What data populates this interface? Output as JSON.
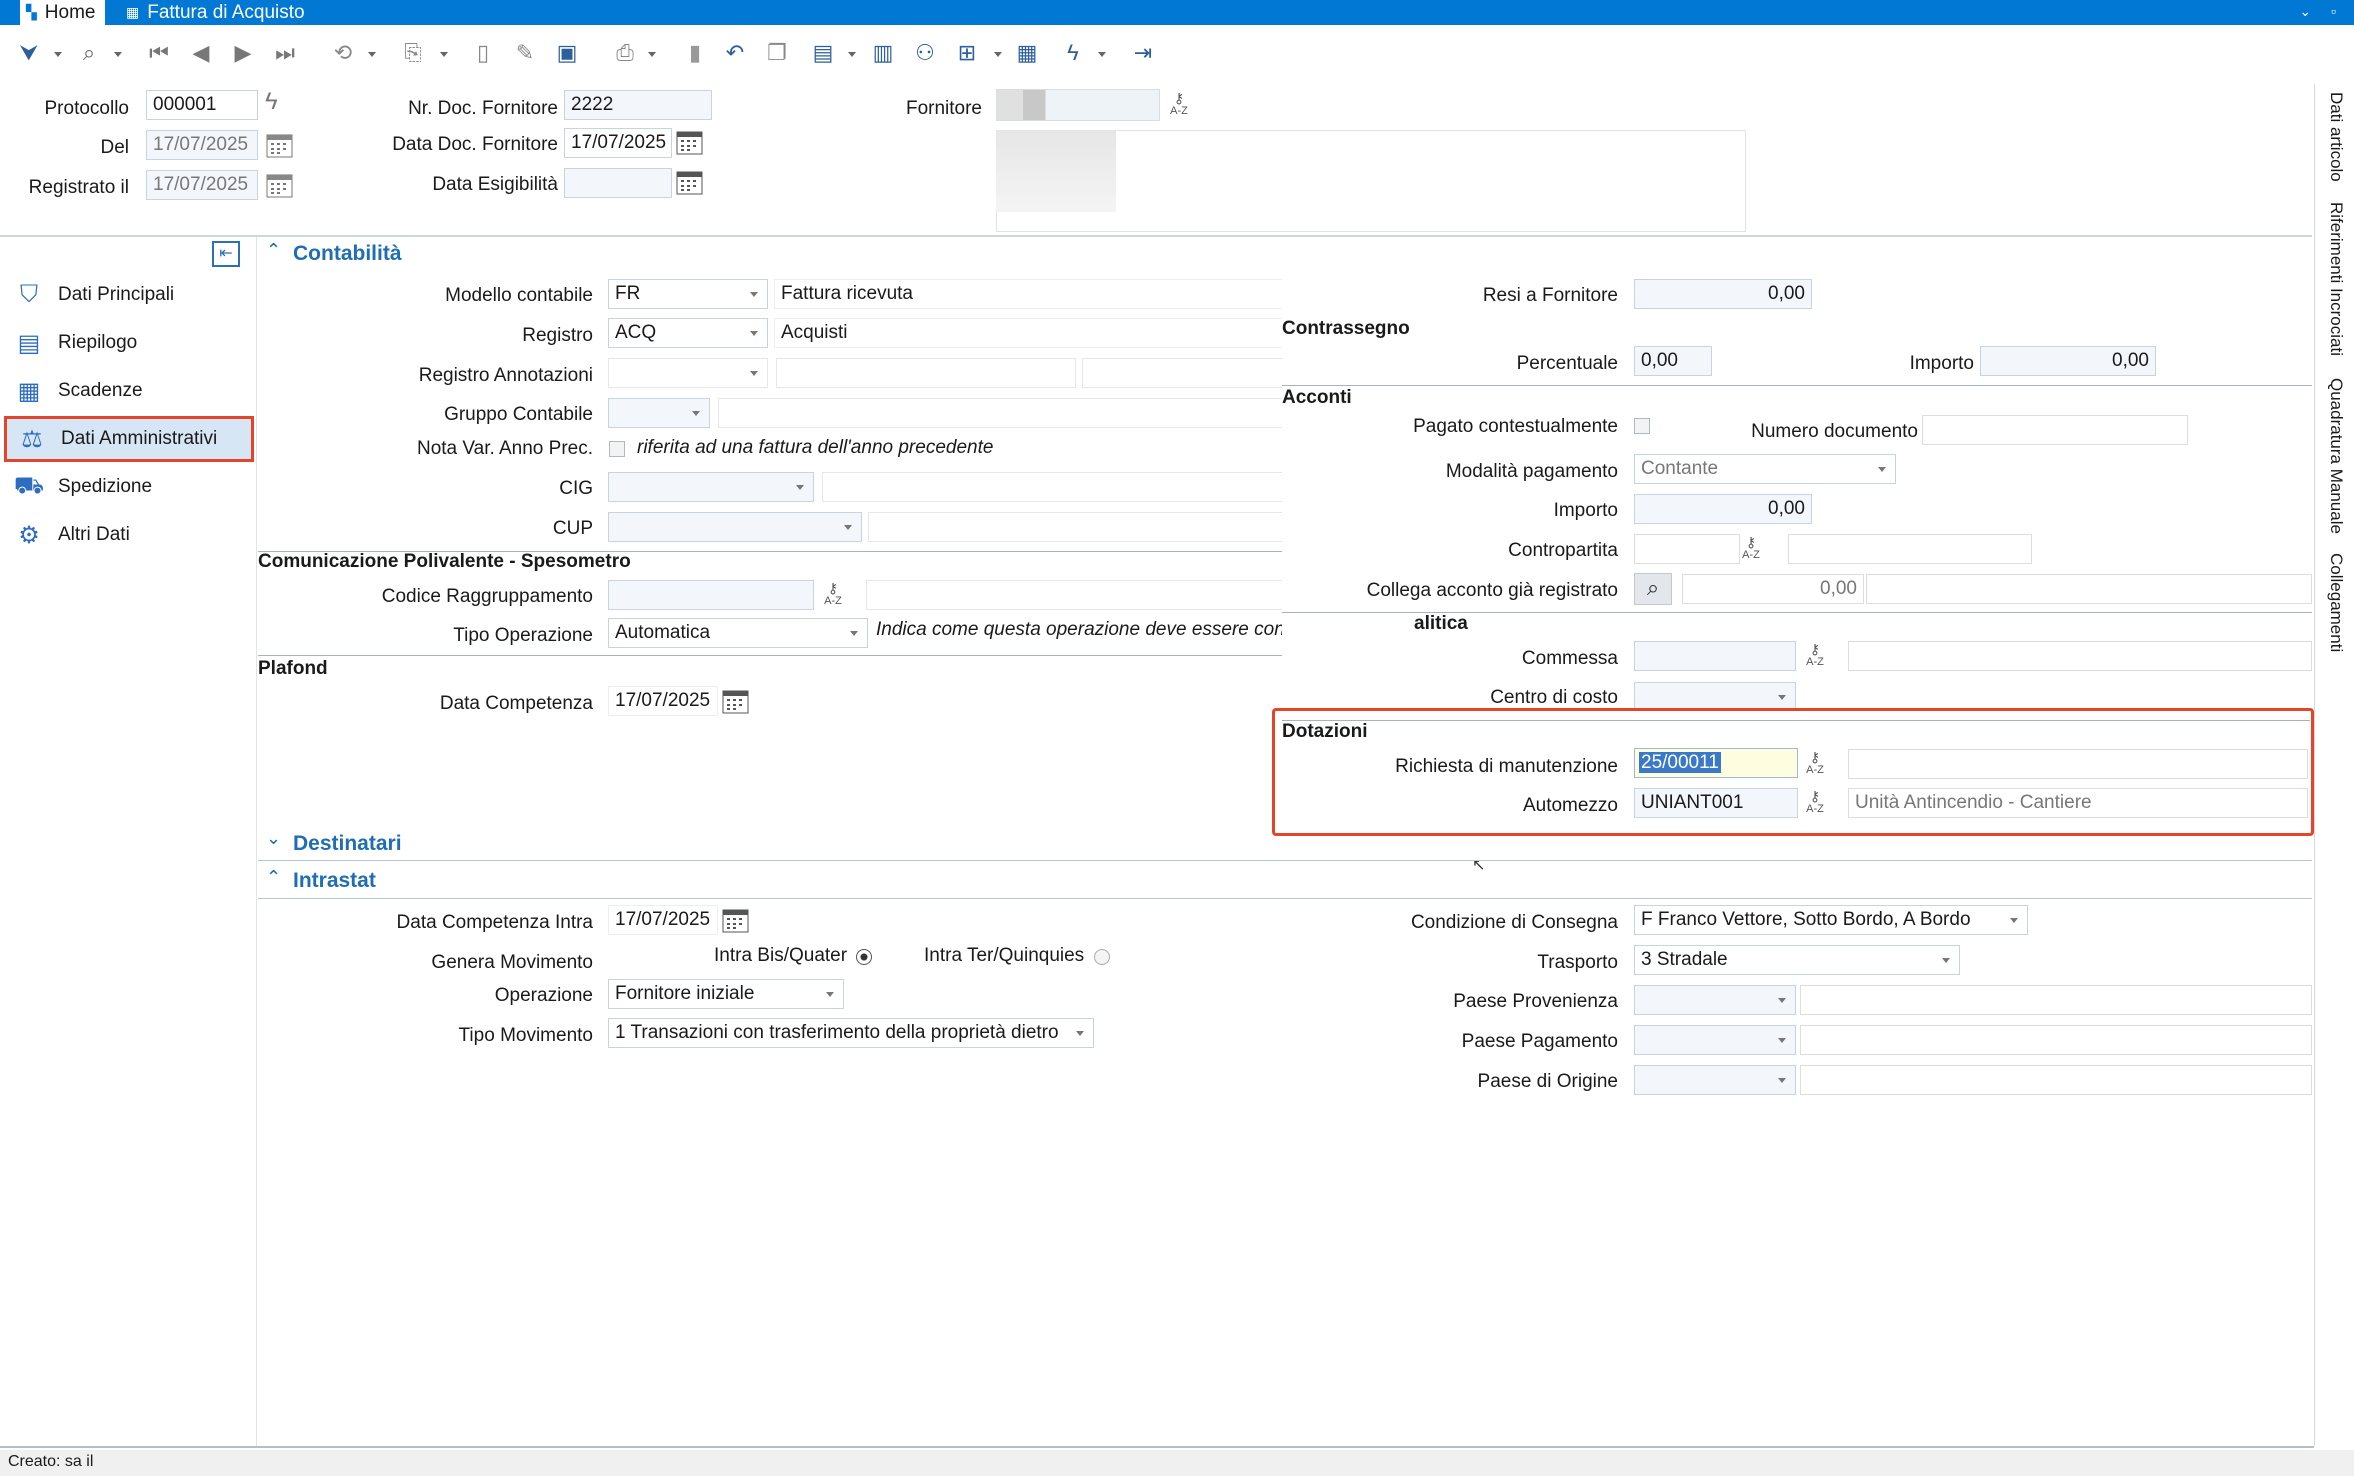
{
  "window": {
    "tabs": [
      {
        "label": "Home"
      },
      {
        "label": "Fattura di Acquisto"
      }
    ]
  },
  "colors": {
    "title_bar": "#0078d4",
    "highlight": "#e4442a",
    "section_header": "#1f6db4",
    "active_nav": "#d6e6f5"
  },
  "header": {
    "protocollo": {
      "label": "Protocollo",
      "value": "000001"
    },
    "del": {
      "label": "Del",
      "value": "17/07/2025"
    },
    "registrato": {
      "label": "Registrato il",
      "value": "17/07/2025"
    },
    "nr_doc": {
      "label": "Nr. Doc. Fornitore",
      "value": "2222"
    },
    "data_doc": {
      "label": "Data Doc. Fornitore",
      "value": "17/07/2025"
    },
    "data_esig": {
      "label": "Data Esigibilità",
      "value": ""
    },
    "fornitore": {
      "label": "Fornitore"
    }
  },
  "sidebar": {
    "items": [
      {
        "label": "Dati Principali",
        "icon": "bag-icon"
      },
      {
        "label": "Riepilogo",
        "icon": "summary-icon"
      },
      {
        "label": "Scadenze",
        "icon": "calendar-icon"
      },
      {
        "label": "Dati Amministrativi",
        "icon": "admin-icon"
      },
      {
        "label": "Spedizione",
        "icon": "truck-icon"
      },
      {
        "label": "Altri Dati",
        "icon": "other-data-icon"
      }
    ]
  },
  "right_tabs": [
    "Dati articolo",
    "Riferimenti Incrociati",
    "Quadratura Manuale",
    "Collegamenti"
  ],
  "contabilita": {
    "title": "Contabilità",
    "modello": {
      "label": "Modello contabile",
      "code": "FR",
      "desc": "Fattura ricevuta"
    },
    "registro": {
      "label": "Registro",
      "code": "ACQ",
      "desc": "Acquisti"
    },
    "registro_ann": {
      "label": "Registro Annotazioni"
    },
    "gruppo": {
      "label": "Gruppo Contabile"
    },
    "nota": {
      "label": "Nota Var. Anno Prec.",
      "text": "riferita ad una fattura dell'anno precedente"
    },
    "cig": {
      "label": "CIG"
    },
    "cup": {
      "label": "CUP"
    },
    "comunicazione": {
      "title": "Comunicazione Polivalente - Spesometro",
      "codice_label": "Codice Raggruppamento",
      "tipo_label": "Tipo Operazione",
      "tipo_value": "Automatica",
      "tipo_note": "Indica come questa operazione deve essere considerata"
    },
    "plafond": {
      "title": "Plafond",
      "data_label": "Data Competenza",
      "data_value": "17/07/2025"
    },
    "resi": {
      "label": "Resi a Fornitore",
      "value": "0,00"
    },
    "contrassegno": {
      "title": "Contrassegno",
      "perc_label": "Percentuale",
      "perc_value": "0,00",
      "imp_label": "Importo",
      "imp_value": "0,00"
    },
    "acconti": {
      "title": "Acconti",
      "pagato_label": "Pagato contestualmente",
      "numdoc_label": "Numero documento",
      "modalita_label": "Modalità pagamento",
      "modalita_value": "Contante",
      "importo_label": "Importo",
      "importo_value": "0,00",
      "contropartita_label": "Contropartita",
      "collega_label": "Collega acconto già registrato",
      "collega_value": "0,00"
    },
    "analitica": {
      "title": "alitica",
      "commessa_label": "Commessa",
      "centro_label": "Centro di costo"
    },
    "dotazioni": {
      "title": "Dotazioni",
      "richiesta_label": "Richiesta di manutenzione",
      "richiesta_value": "25/00011",
      "automezzo_label": "Automezzo",
      "automezzo_value": "UNIANT001",
      "automezzo_desc": "Unità Antincendio - Cantiere"
    }
  },
  "destinatari": {
    "title": "Destinatari"
  },
  "intrastat": {
    "title": "Intrastat",
    "data_label": "Data Competenza Intra",
    "data_value": "17/07/2025",
    "genera_label": "Genera Movimento",
    "radio1": "Intra Bis/Quater",
    "radio2": "Intra Ter/Quinquies",
    "operazione_label": "Operazione",
    "operazione_value": "Fornitore iniziale",
    "tipo_mov_label": "Tipo Movimento",
    "tipo_mov_value": "1  Transazioni con trasferimento della proprietà dietro",
    "condizione_label": "Condizione di Consegna",
    "condizione_value": "F  Franco Vettore, Sotto Bordo, A Bordo",
    "trasporto_label": "Trasporto",
    "trasporto_value": "3 Stradale",
    "provenienza_label": "Paese Provenienza",
    "pagamento_label": "Paese Pagamento",
    "origine_label": "Paese di Origine"
  },
  "status": {
    "text": "Creato: sa il"
  }
}
